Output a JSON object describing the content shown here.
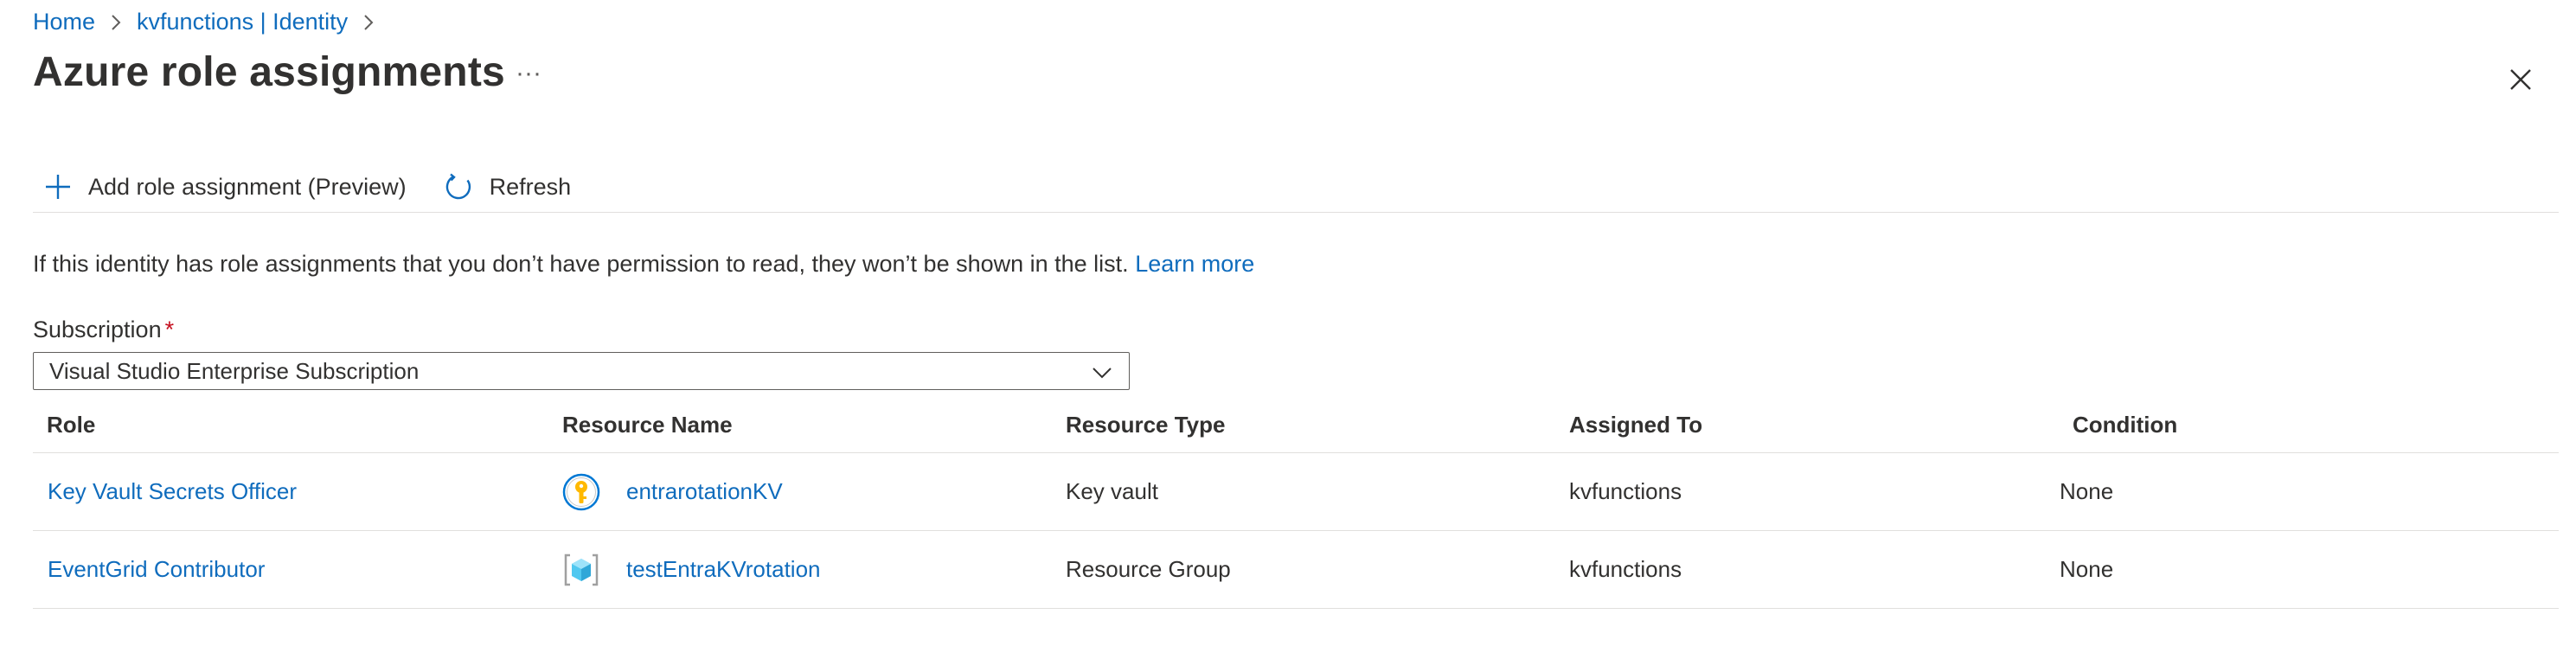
{
  "breadcrumb": {
    "items": [
      "Home",
      "kvfunctions | Identity"
    ]
  },
  "page": {
    "title": "Azure role assignments",
    "more": "···"
  },
  "toolbar": {
    "add_label": "Add role assignment (Preview)",
    "refresh_label": "Refresh"
  },
  "info": {
    "text": "If this identity has role assignments that you don’t have permission to read, they won’t be shown in the list.",
    "link": "Learn more"
  },
  "subscription": {
    "label": "Subscription",
    "required_mark": "*",
    "selected": "Visual Studio Enterprise Subscription"
  },
  "table": {
    "headers": [
      "Role",
      "Resource Name",
      "Resource Type",
      "Assigned To",
      "Condition"
    ],
    "rows": [
      {
        "role": "Key Vault Secrets Officer",
        "resource_name": "entrarotationKV",
        "resource_icon": "key-vault-icon",
        "resource_type": "Key vault",
        "assigned_to": "kvfunctions",
        "condition": "None"
      },
      {
        "role": "EventGrid Contributor",
        "resource_name": "testEntraKVrotation",
        "resource_icon": "resource-group-icon",
        "resource_type": "Resource Group",
        "assigned_to": "kvfunctions",
        "condition": "None"
      }
    ]
  },
  "colors": {
    "link": "#0f6cbd",
    "text": "#323130",
    "required": "#c50f1f",
    "divider": "#e1dfdd"
  }
}
